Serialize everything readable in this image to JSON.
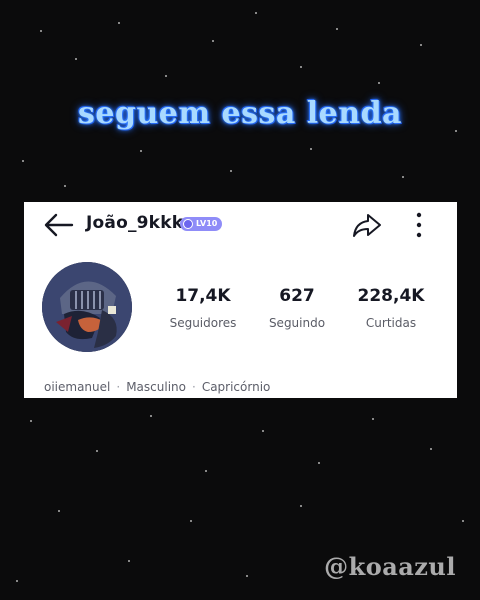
{
  "caption": "seguem essa lenda",
  "profile": {
    "username": "João_9kkk",
    "level_badge": "LV10",
    "stats": [
      {
        "value": "17,4K",
        "label": "Seguidores"
      },
      {
        "value": "627",
        "label": "Seguindo"
      },
      {
        "value": "228,4K",
        "label": "Curtidas"
      }
    ],
    "bio": {
      "handle": "oiiemanuel",
      "sep1": "·",
      "gender": "Masculino",
      "sep2": "·",
      "sign": "Capricórnio"
    }
  },
  "watermark": "@koaazul",
  "colors": {
    "background": "#0b0b0c",
    "caption": "#a9d9ff",
    "caption_glow": "#2f7dff",
    "badge": "#8f8cf8",
    "text": "#161823"
  },
  "icons": [
    "back-arrow-icon",
    "level-badge-icon",
    "share-icon",
    "more-vertical-icon"
  ]
}
